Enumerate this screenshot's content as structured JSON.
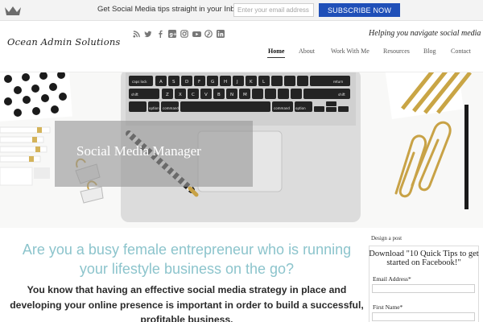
{
  "optin_bar": {
    "message": "Get Social Media tips straight in your Inbox",
    "email_placeholder": "Enter your email address",
    "subscribe_label": "SUBSCRIBE NOW"
  },
  "header": {
    "logo_text": "Ocean Admin Solutions",
    "tagline": "Helping you navigate social media",
    "social_icons": [
      "rss-icon",
      "twitter-icon",
      "facebook-icon",
      "google-plus-icon",
      "instagram-icon",
      "youtube-icon",
      "pinterest-icon",
      "linkedin-icon"
    ],
    "nav": [
      {
        "label": "Home",
        "active": true
      },
      {
        "label": "About",
        "active": false
      },
      {
        "label": "Work With Me",
        "active": false
      },
      {
        "label": "Resources",
        "active": false
      },
      {
        "label": "Blog",
        "active": false
      },
      {
        "label": "Contact",
        "active": false
      }
    ]
  },
  "hero": {
    "title": "Social Media Manager",
    "keyboard_keys": [
      "caps lock",
      "shift",
      "control",
      "option",
      "command",
      "command",
      "option",
      "return",
      "shift"
    ],
    "keyboard_letters_row1": [
      "A",
      "S",
      "D",
      "F",
      "G",
      "H",
      "J",
      "K",
      "L"
    ],
    "keyboard_letters_row2": [
      "Z",
      "X",
      "C",
      "V",
      "B",
      "N",
      "M"
    ]
  },
  "main": {
    "headline": "Are you a busy female entrepreneur who is running your lifestyle business on the go?",
    "body": "You know that having an effective social media strategy in place and developing your online presence is important in order to build a successful, profitable business."
  },
  "sidebar": {
    "caption": "Design a post",
    "title": "Download \"10 Quick Tips to get started on Facebook!\"",
    "email_label": "Email Address*",
    "first_name_label": "First Name*"
  },
  "colors": {
    "subscribe_button": "#1f4fb8",
    "headline": "#8cc4cc",
    "hero_overlay": "#969696"
  }
}
